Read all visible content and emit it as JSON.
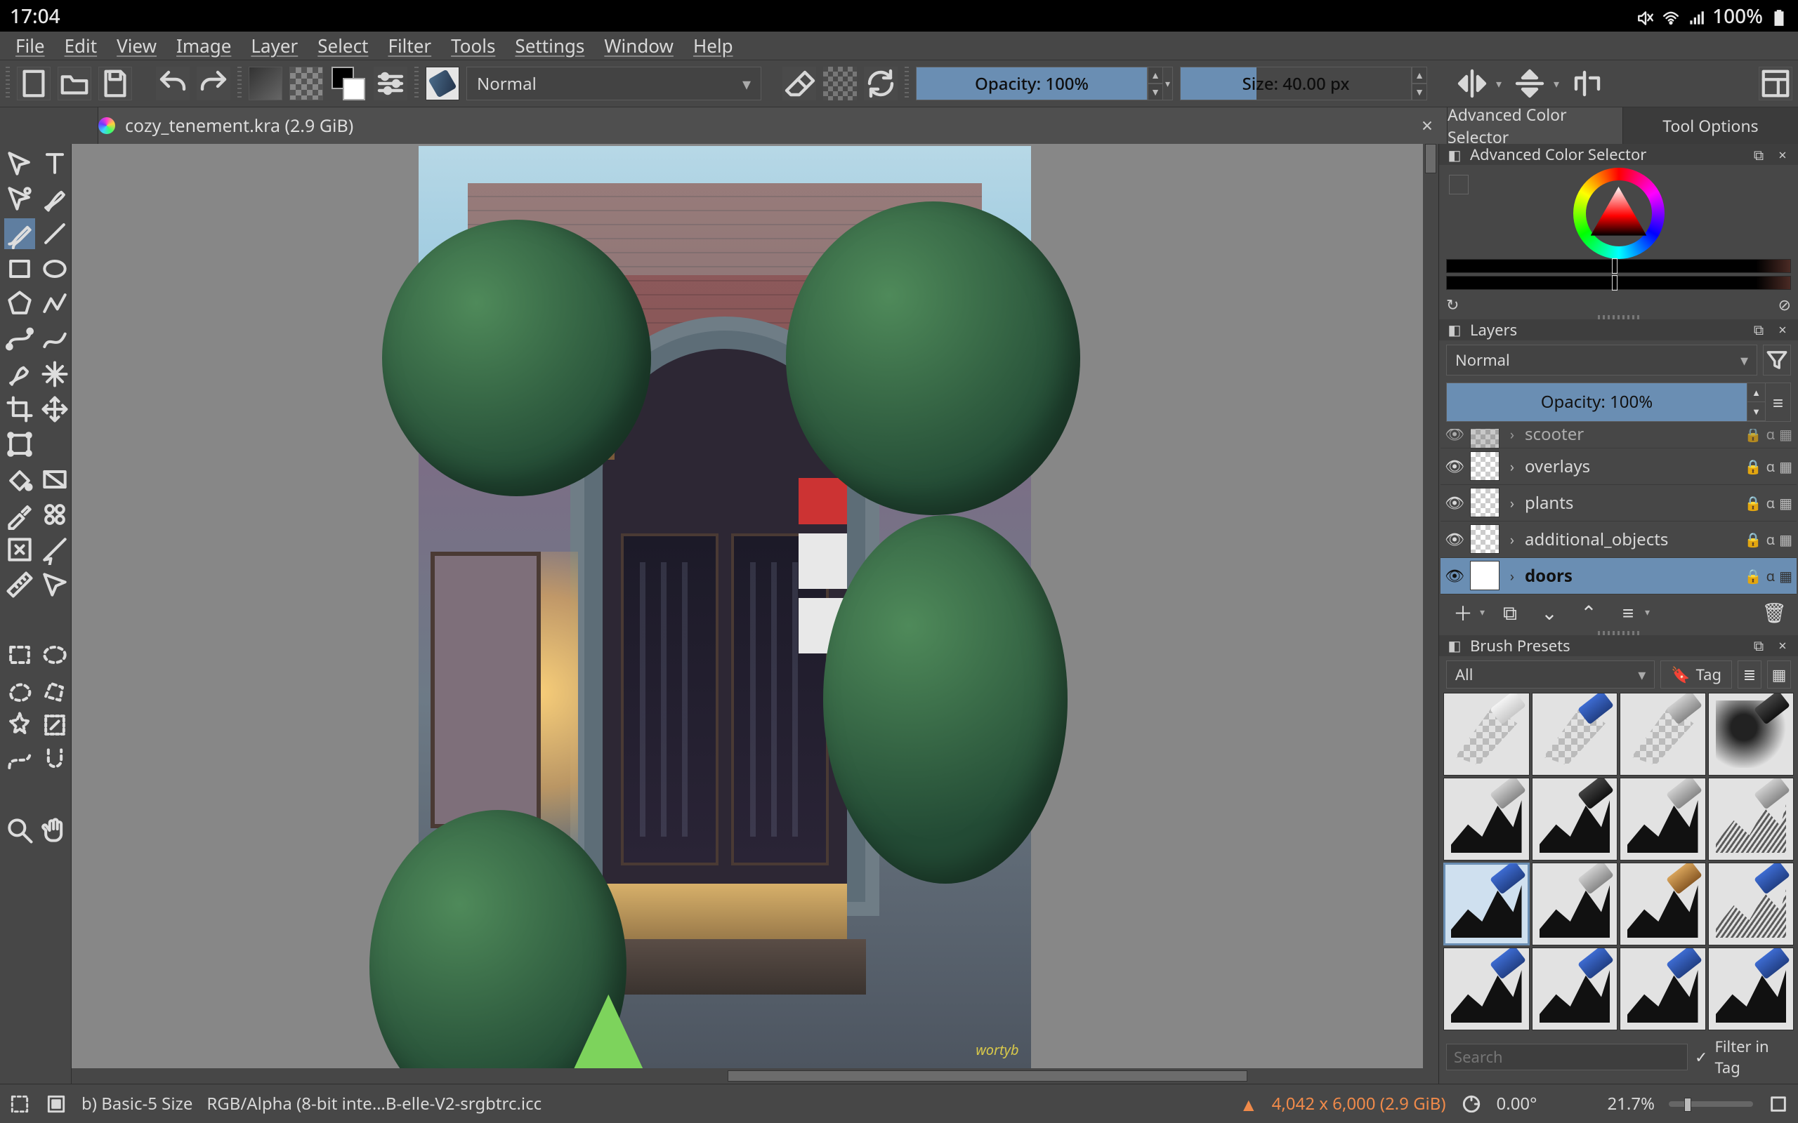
{
  "status_bar_os": {
    "time": "17:04",
    "battery": "100%"
  },
  "menu": [
    "File",
    "Edit",
    "View",
    "Image",
    "Layer",
    "Select",
    "Filter",
    "Tools",
    "Settings",
    "Window",
    "Help"
  ],
  "toolbar": {
    "blend_mode": "Normal",
    "opacity_label": "Opacity: 100%",
    "size_label": "Size: 40.00 px"
  },
  "document": {
    "tab_title": "cozy_tenement.kra (2.9 GiB)"
  },
  "right_tabs": {
    "color": "Advanced Color Selector",
    "tool": "Tool Options"
  },
  "color_docker": {
    "title": "Advanced Color Selector"
  },
  "layers_docker": {
    "title": "Layers",
    "blend_mode": "Normal",
    "opacity_label": "Opacity:  100%",
    "items": [
      {
        "name": "scooter",
        "selected": false,
        "clipped": true
      },
      {
        "name": "overlays",
        "selected": false
      },
      {
        "name": "plants",
        "selected": false
      },
      {
        "name": "additional_objects",
        "selected": false
      },
      {
        "name": "doors",
        "selected": true
      }
    ]
  },
  "presets_docker": {
    "title": "Brush Presets",
    "tag_filter": "All",
    "tag_button": "Tag",
    "search_placeholder": "Search",
    "filter_in_tag_label": "Filter in Tag"
  },
  "statusbar": {
    "brush": "b) Basic-5 Size",
    "color_profile": "RGB/Alpha (8-bit inte…B-elle-V2-srgbtrc.icc",
    "dimensions": "4,042 x 6,000 (2.9 GiB)",
    "rotation": "0.00°",
    "zoom": "21.7%"
  },
  "canvas_signature": "wortyb"
}
